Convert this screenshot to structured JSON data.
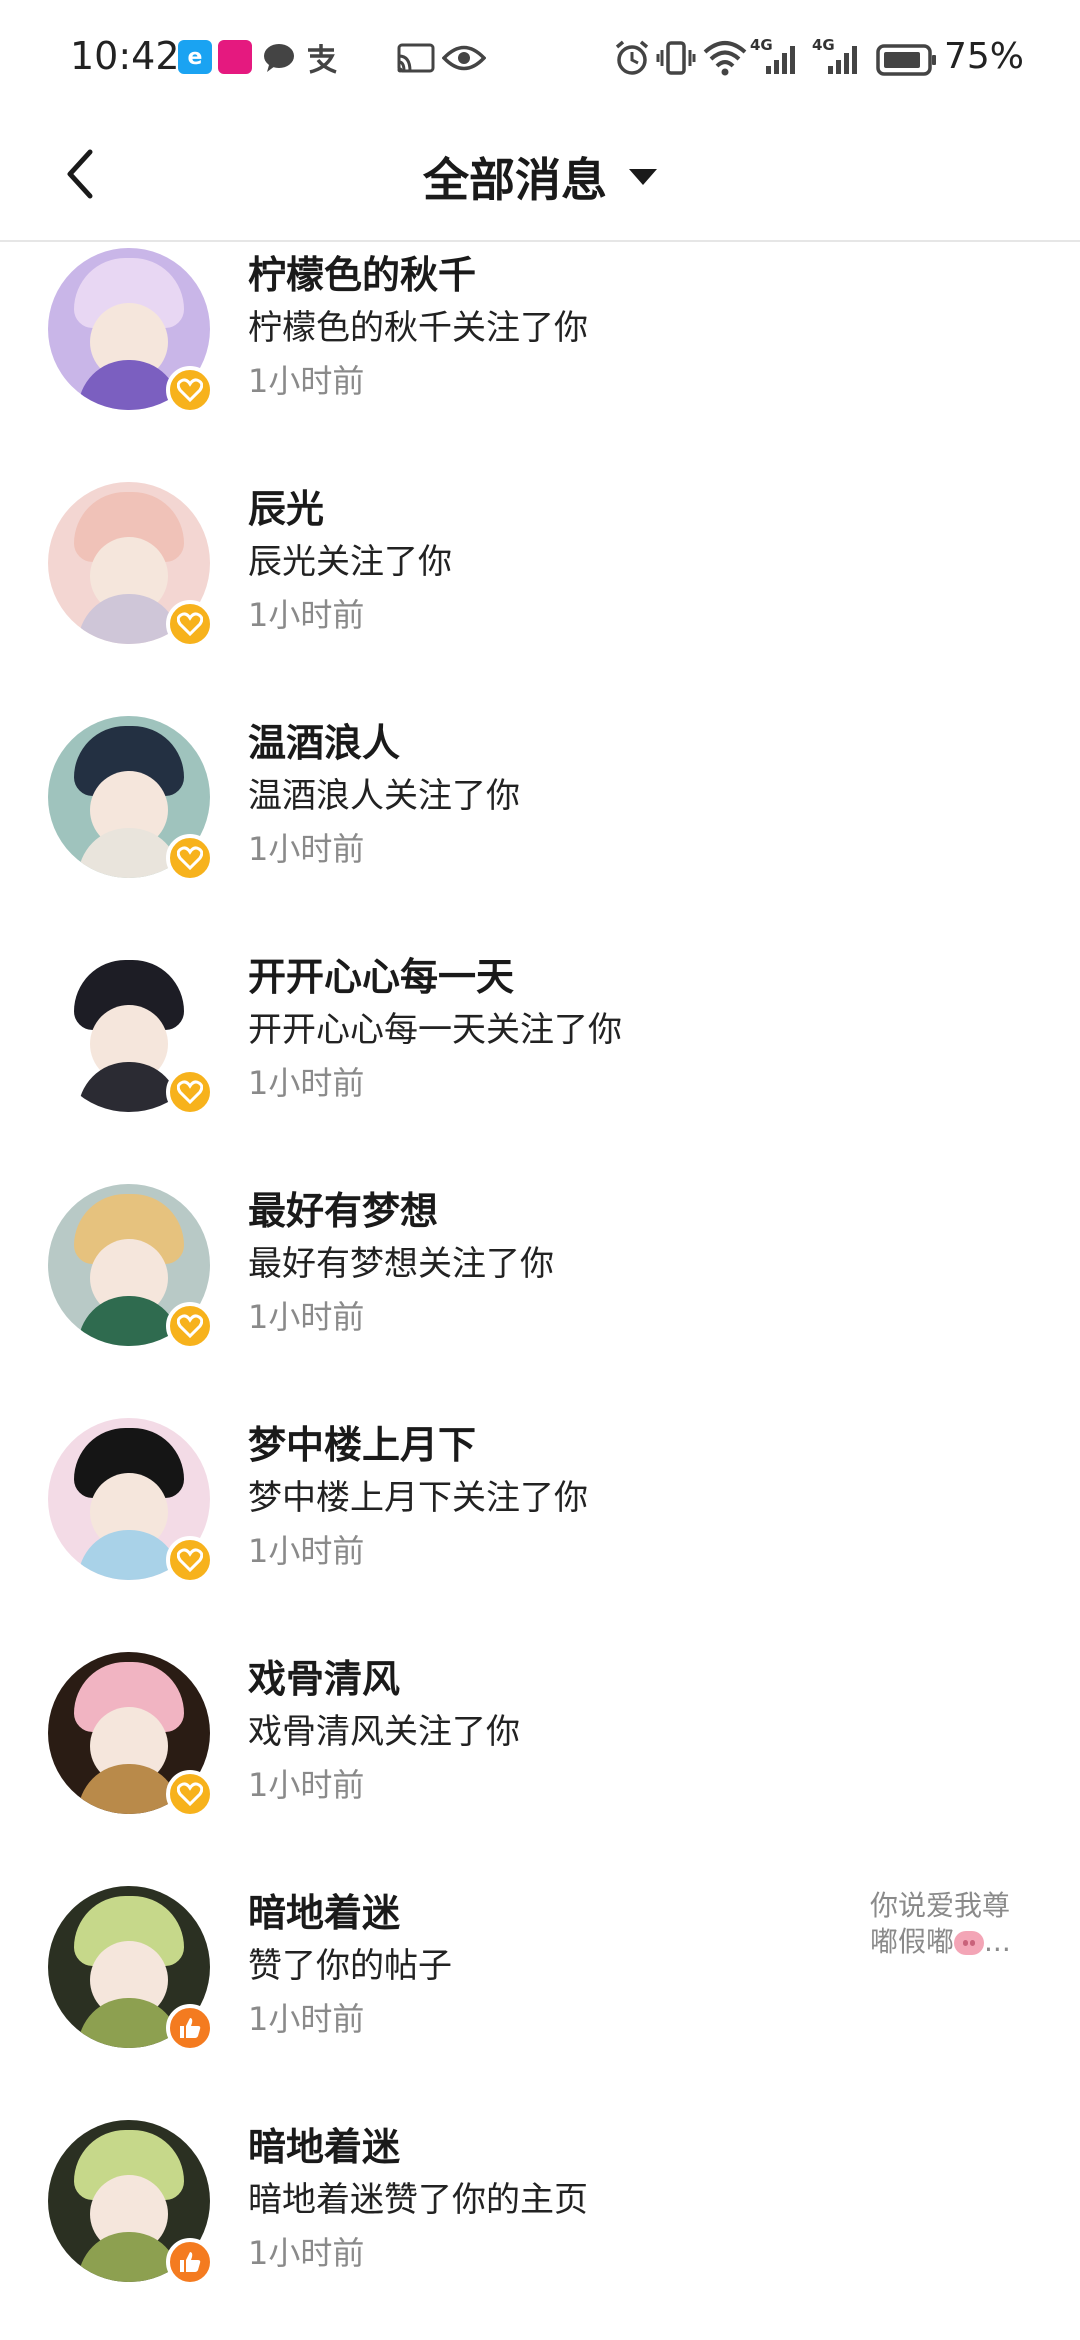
{
  "status_bar": {
    "time": "10:42",
    "network_labels": [
      "4G",
      "4G"
    ],
    "battery_text": "75%",
    "icons": [
      "eleme-app-icon",
      "vip-app-icon",
      "chat-bubble-icon",
      "alipay-icon",
      "cast-icon",
      "eye-icon",
      "alarm-icon",
      "vibrate-icon",
      "wifi-icon",
      "signal-icon",
      "signal-icon",
      "battery-icon"
    ]
  },
  "header": {
    "title": "全部消息",
    "back_icon": "chevron-left-icon",
    "dropdown_icon": "caret-down-icon"
  },
  "messages": [
    {
      "name": "柠檬色的秋千",
      "desc": "柠檬色的秋千关注了你",
      "time": "1小时前",
      "type": "follow",
      "avatar_colors": [
        "#c9b6e8",
        "#e8d7f3",
        "#7b5fc0"
      ]
    },
    {
      "name": "辰光",
      "desc": "辰光关注了你",
      "time": "1小时前",
      "type": "follow",
      "avatar_colors": [
        "#f3d6d2",
        "#f0c2b8",
        "#cfc6d8"
      ]
    },
    {
      "name": "温酒浪人",
      "desc": "温酒浪人关注了你",
      "time": "1小时前",
      "type": "follow",
      "avatar_colors": [
        "#9fc3bd",
        "#233042",
        "#e9e4dc"
      ]
    },
    {
      "name": "开开心心每一天",
      "desc": "开开心心每一天关注了你",
      "time": "1小时前",
      "type": "follow",
      "avatar_colors": [
        "#ffffff",
        "#1d1d25",
        "#2b2b33"
      ]
    },
    {
      "name": "最好有梦想",
      "desc": "最好有梦想关注了你",
      "time": "1小时前",
      "type": "follow",
      "avatar_colors": [
        "#b8c9c6",
        "#e6c27e",
        "#2f6b4f"
      ]
    },
    {
      "name": "梦中楼上月下",
      "desc": "梦中楼上月下关注了你",
      "time": "1小时前",
      "type": "follow",
      "avatar_colors": [
        "#f3dbe6",
        "#151515",
        "#a9d2e8"
      ]
    },
    {
      "name": "戏骨清风",
      "desc": "戏骨清风关注了你",
      "time": "1小时前",
      "type": "follow",
      "avatar_colors": [
        "#2a1c14",
        "#f1b4c2",
        "#b98a4a"
      ]
    },
    {
      "name": "暗地着迷",
      "desc": "赞了你的帖子",
      "time": "1小时前",
      "type": "like",
      "preview": "你说爱我尊嘟假嘟",
      "preview_suffix": "...",
      "avatar_colors": [
        "#2b3022",
        "#c6d88a",
        "#8da050"
      ]
    },
    {
      "name": "暗地着迷",
      "desc": "暗地着迷赞了你的主页",
      "time": "1小时前",
      "type": "like",
      "avatar_colors": [
        "#2b3022",
        "#c6d88a",
        "#8da050"
      ]
    }
  ]
}
